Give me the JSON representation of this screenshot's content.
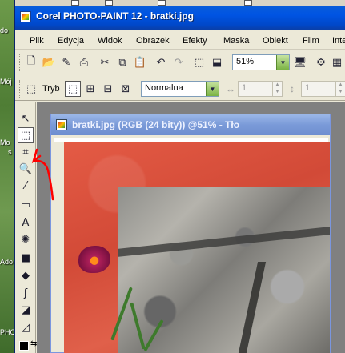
{
  "desktop": {
    "labels": [
      "do",
      "Mój",
      "Mo",
      "s",
      "Ado",
      "PHC"
    ]
  },
  "window": {
    "title": "Corel PHOTO-PAINT 12 - bratki.jpg"
  },
  "menu": {
    "items": [
      "Plik",
      "Edycja",
      "Widok",
      "Obrazek",
      "Efekty",
      "Maska",
      "Obiekt",
      "Film",
      "Inte"
    ]
  },
  "toolbar": {
    "zoom_value": "51%"
  },
  "property_bar": {
    "mode_label": "Tryb",
    "blend_mode": "Normalna",
    "width_value": "1",
    "height_value": "1"
  },
  "document": {
    "title": "bratki.jpg (RGB (24 bity)) @51% - Tło"
  },
  "colors": {
    "mask_overlay": "#d9523e",
    "annotation": "#ff0000",
    "title_active": "#0054e3",
    "title_inactive": "#7a9ad8"
  },
  "icons": {
    "toolbar": [
      "new-icon",
      "open-icon",
      "print-icon",
      "cut-icon",
      "copy-icon",
      "paste-icon",
      "undo-icon",
      "redo-icon",
      "import-icon",
      "export-icon",
      "app-launcher-icon",
      "options-icon"
    ],
    "toolbox": [
      "pick-icon",
      "rectangle-mask-icon",
      "crop-icon",
      "zoom-icon",
      "eyedropper-icon",
      "eraser-icon",
      "text-icon",
      "effect-icon",
      "rectangle-icon",
      "fill-icon",
      "brush-icon",
      "shadow-icon",
      "transparency-icon"
    ]
  }
}
